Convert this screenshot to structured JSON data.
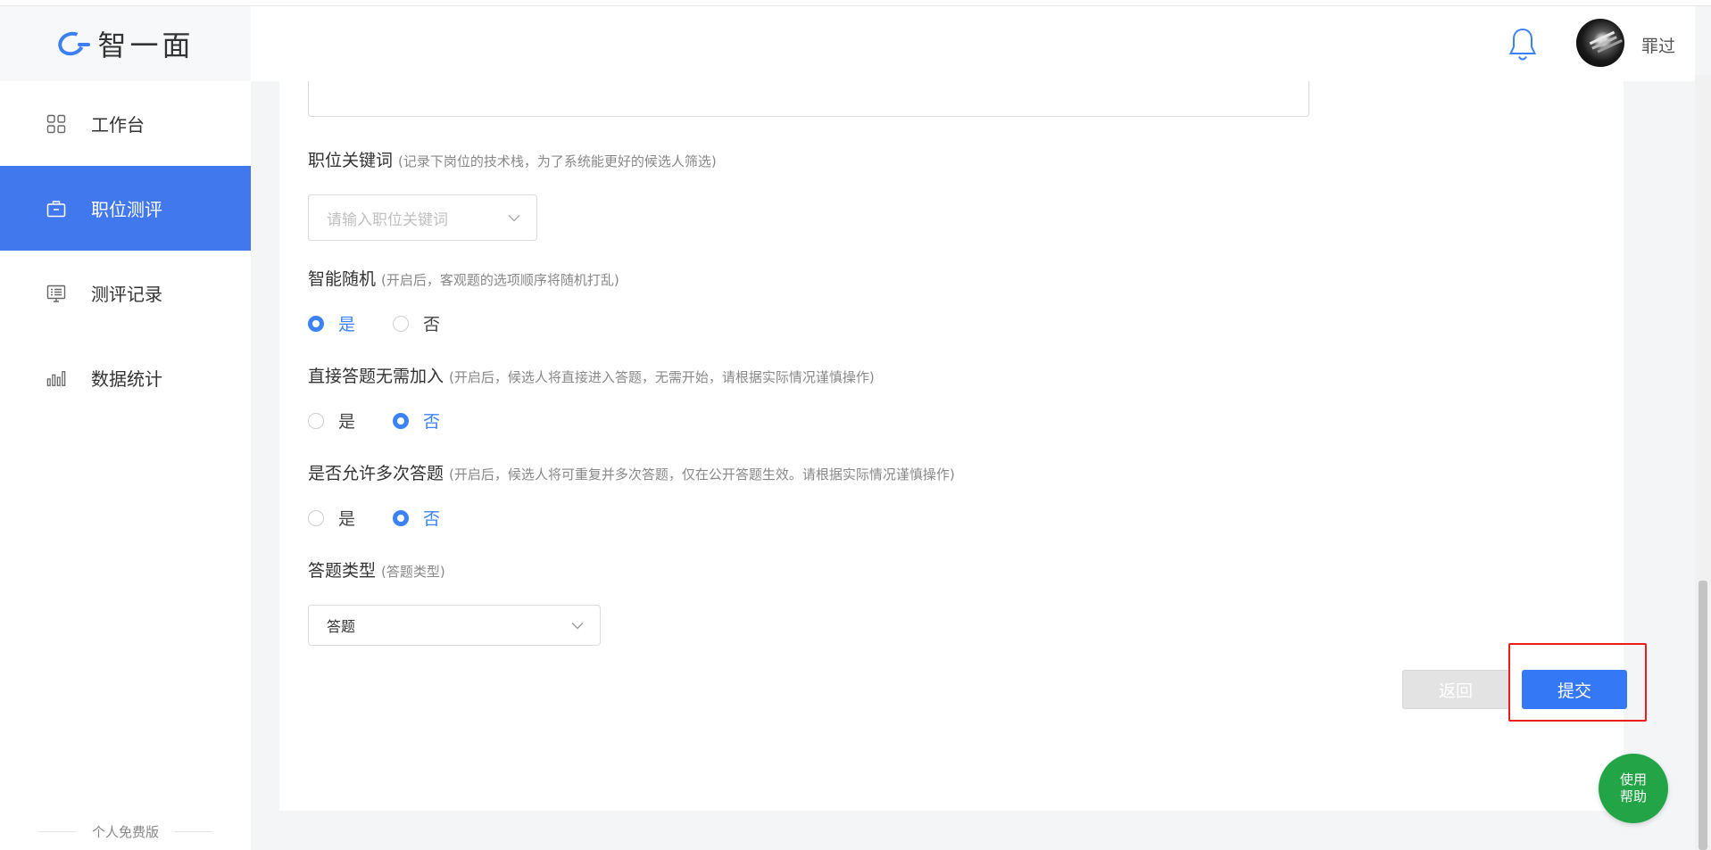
{
  "app": {
    "logo_text": "智一面"
  },
  "sidebar": {
    "items": [
      {
        "label": "工作台",
        "icon": "grid-icon",
        "active": false
      },
      {
        "label": "职位测评",
        "icon": "briefcase-icon",
        "active": true
      },
      {
        "label": "测评记录",
        "icon": "record-list-icon",
        "active": false
      },
      {
        "label": "数据统计",
        "icon": "bar-chart-icon",
        "active": false
      }
    ],
    "footer": "个人免费版"
  },
  "header": {
    "username": "罪过"
  },
  "form": {
    "keyword": {
      "label": "职位关键词",
      "hint": "(记录下岗位的技术栈，为了系统能更好的候选人筛选)",
      "placeholder": "请输入职位关键词"
    },
    "random": {
      "label": "智能随机",
      "hint": "(开启后，客观题的选项顺序将随机打乱)",
      "yes": "是",
      "no": "否",
      "selected": "是"
    },
    "direct": {
      "label": "直接答题无需加入",
      "hint": "(开启后，候选人将直接进入答题，无需开始，请根据实际情况谨慎操作)",
      "yes": "是",
      "no": "否",
      "selected": "否"
    },
    "multiple": {
      "label": "是否允许多次答题",
      "hint": "(开启后，候选人将可重复并多次答题，仅在公开答题生效。请根据实际情况谨慎操作)",
      "yes": "是",
      "no": "否",
      "selected": "否"
    },
    "answer_type": {
      "label": "答题类型",
      "hint": "(答题类型)",
      "value": "答题"
    },
    "back_label": "返回",
    "submit_label": "提交"
  },
  "help": {
    "line1": "使用",
    "line2": "帮助"
  },
  "colors": {
    "accent": "#3478f6",
    "sidebar_active": "#4278ee",
    "help": "#22a447",
    "highlight": "#ee1b1b"
  }
}
